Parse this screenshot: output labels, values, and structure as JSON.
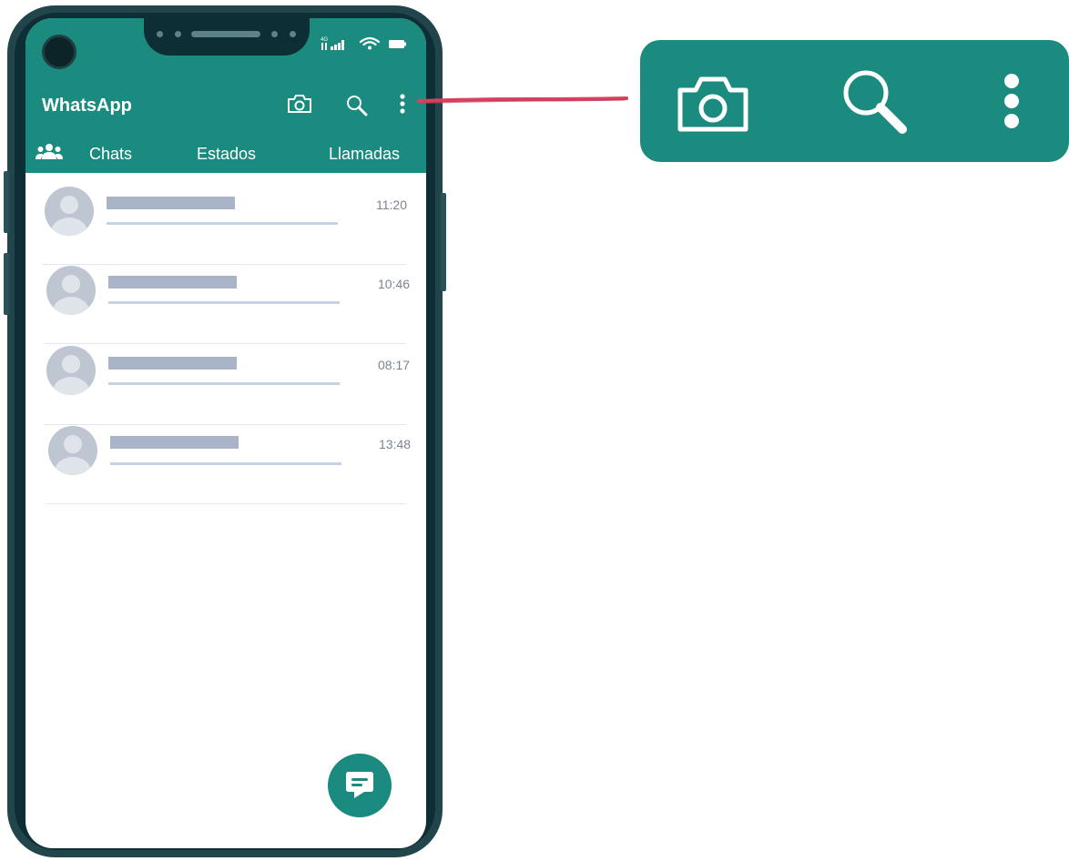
{
  "app": {
    "title": "WhatsApp",
    "tabs": [
      {
        "label": "Chats"
      },
      {
        "label": "Estados"
      },
      {
        "label": "Llamadas"
      }
    ]
  },
  "header_icons": [
    "camera-icon",
    "search-icon",
    "more-vertical-icon"
  ],
  "chats": [
    {
      "time": "11:20"
    },
    {
      "time": "10:46"
    },
    {
      "time": "08:17"
    },
    {
      "time": "13:48"
    }
  ],
  "fab_icon": "new-chat-icon",
  "colors": {
    "brand": "#1a8b7e",
    "frame": "#22454c",
    "callout_line": "#d6415f",
    "placeholder": "#a9b4c8"
  }
}
